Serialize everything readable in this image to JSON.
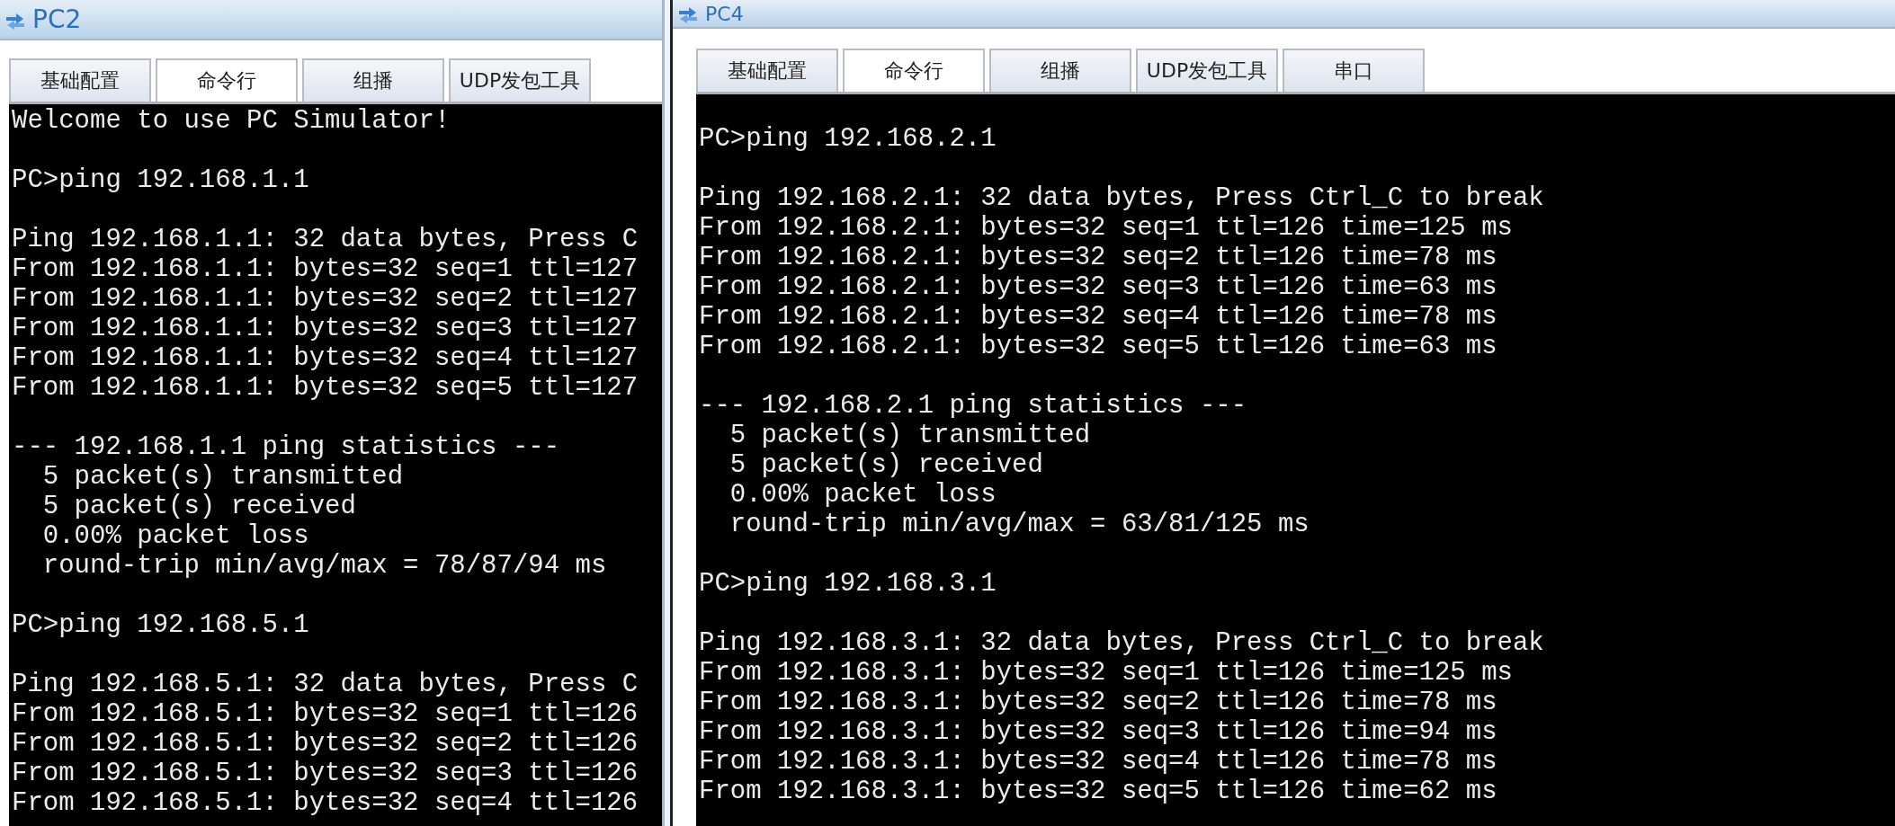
{
  "windows": [
    {
      "title": "PC2",
      "scrolled": false,
      "tabs": [
        {
          "label": "基础配置",
          "selected": false
        },
        {
          "label": "命令行",
          "selected": true
        },
        {
          "label": "组播",
          "selected": false
        },
        {
          "label": "UDP发包工具",
          "selected": false
        }
      ],
      "blocks": [
        [
          "Welcome to use PC Simulator!"
        ],
        [
          "PC>ping 192.168.1.1"
        ],
        [
          "Ping 192.168.1.1: 32 data bytes, Press C",
          "From 192.168.1.1: bytes=32 seq=1 ttl=127",
          "From 192.168.1.1: bytes=32 seq=2 ttl=127",
          "From 192.168.1.1: bytes=32 seq=3 ttl=127",
          "From 192.168.1.1: bytes=32 seq=4 ttl=127",
          "From 192.168.1.1: bytes=32 seq=5 ttl=127"
        ],
        [
          "--- 192.168.1.1 ping statistics ---",
          "  5 packet(s) transmitted",
          "  5 packet(s) received",
          "  0.00% packet loss",
          "  round-trip min/avg/max = 78/87/94 ms"
        ],
        [
          "PC>ping 192.168.5.1"
        ],
        [
          "Ping 192.168.5.1: 32 data bytes, Press C",
          "From 192.168.5.1: bytes=32 seq=1 ttl=126",
          "From 192.168.5.1: bytes=32 seq=2 ttl=126",
          "From 192.168.5.1: bytes=32 seq=3 ttl=126",
          "From 192.168.5.1: bytes=32 seq=4 ttl=126"
        ]
      ]
    },
    {
      "title": "PC4",
      "scrolled": true,
      "tabs": [
        {
          "label": "基础配置",
          "selected": false
        },
        {
          "label": "命令行",
          "selected": true
        },
        {
          "label": "组播",
          "selected": false
        },
        {
          "label": "UDP发包工具",
          "selected": false
        },
        {
          "label": "串口",
          "selected": false
        }
      ],
      "blocks": [
        [
          "PC>ping 192.168.2.1"
        ],
        [
          "Ping 192.168.2.1: 32 data bytes, Press Ctrl_C to break",
          "From 192.168.2.1: bytes=32 seq=1 ttl=126 time=125 ms",
          "From 192.168.2.1: bytes=32 seq=2 ttl=126 time=78 ms",
          "From 192.168.2.1: bytes=32 seq=3 ttl=126 time=63 ms",
          "From 192.168.2.1: bytes=32 seq=4 ttl=126 time=78 ms",
          "From 192.168.2.1: bytes=32 seq=5 ttl=126 time=63 ms"
        ],
        [
          "--- 192.168.2.1 ping statistics ---",
          "  5 packet(s) transmitted",
          "  5 packet(s) received",
          "  0.00% packet loss",
          "  round-trip min/avg/max = 63/81/125 ms"
        ],
        [
          "PC>ping 192.168.3.1"
        ],
        [
          "Ping 192.168.3.1: 32 data bytes, Press Ctrl_C to break",
          "From 192.168.3.1: bytes=32 seq=1 ttl=126 time=125 ms",
          "From 192.168.3.1: bytes=32 seq=2 ttl=126 time=78 ms",
          "From 192.168.3.1: bytes=32 seq=3 ttl=126 time=94 ms",
          "From 192.168.3.1: bytes=32 seq=4 ttl=126 time=78 ms",
          "From 192.168.3.1: bytes=32 seq=5 ttl=126 time=62 ms"
        ]
      ]
    }
  ]
}
